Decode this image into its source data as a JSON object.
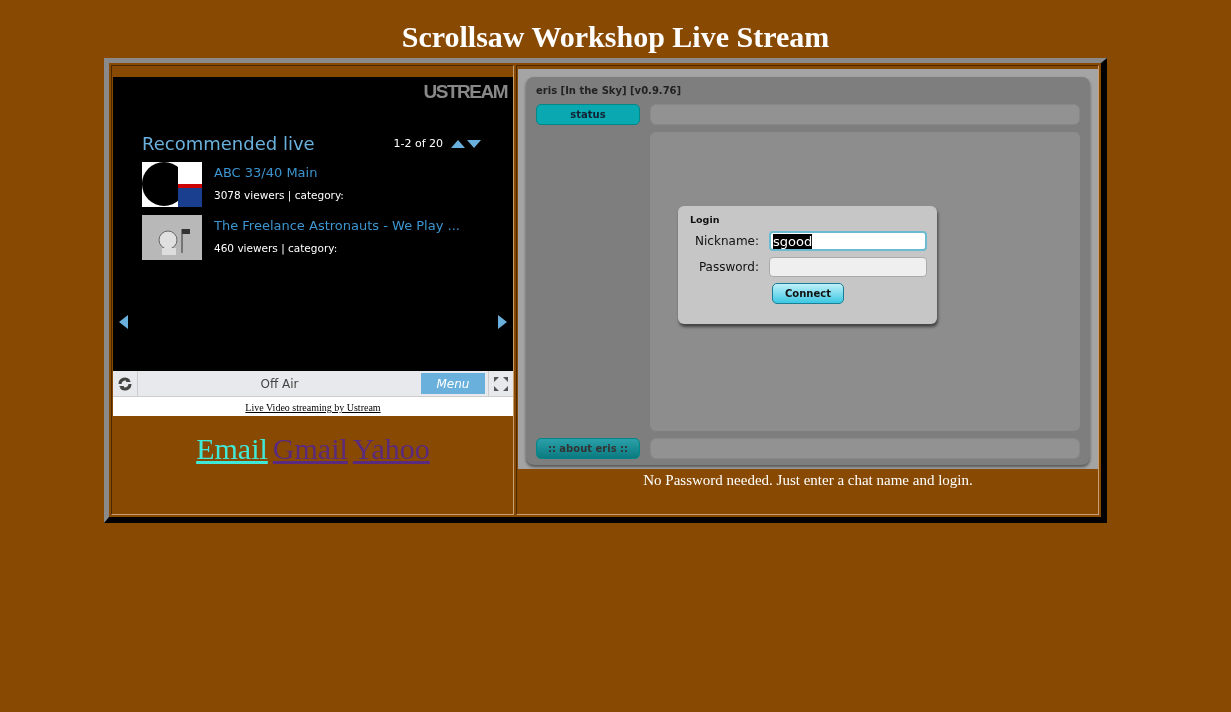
{
  "page_title": "Scrollsaw Workshop Live Stream",
  "player": {
    "brand": "USTREAM",
    "section_title": "Recommended live",
    "range": "1-2 of 20",
    "channels": [
      {
        "kind": "abc",
        "title": "ABC 33/40 Main",
        "meta": "3078 viewers | category:"
      },
      {
        "kind": "astronaut",
        "title": "The Freelance Astronauts - We Play ...",
        "meta": "460 viewers | category:"
      }
    ],
    "status": "Off Air",
    "menu_label": "Menu",
    "credit": "Live Video streaming by Ustream"
  },
  "links": [
    {
      "label": "Email",
      "visited": false
    },
    {
      "label": "Gmail",
      "visited": true
    },
    {
      "label": "Yahoo",
      "visited": true
    }
  ],
  "chat": {
    "title": "eris [In the Sky] [v0.9.76]",
    "status_button": "status",
    "about_button": ":: about eris ::",
    "login": {
      "title": "Login",
      "nickname_label": "Nickname:",
      "nickname_value": "sgood",
      "password_label": "Password:",
      "connect": "Connect"
    }
  },
  "note": "No Password needed. Just enter a chat name and login."
}
